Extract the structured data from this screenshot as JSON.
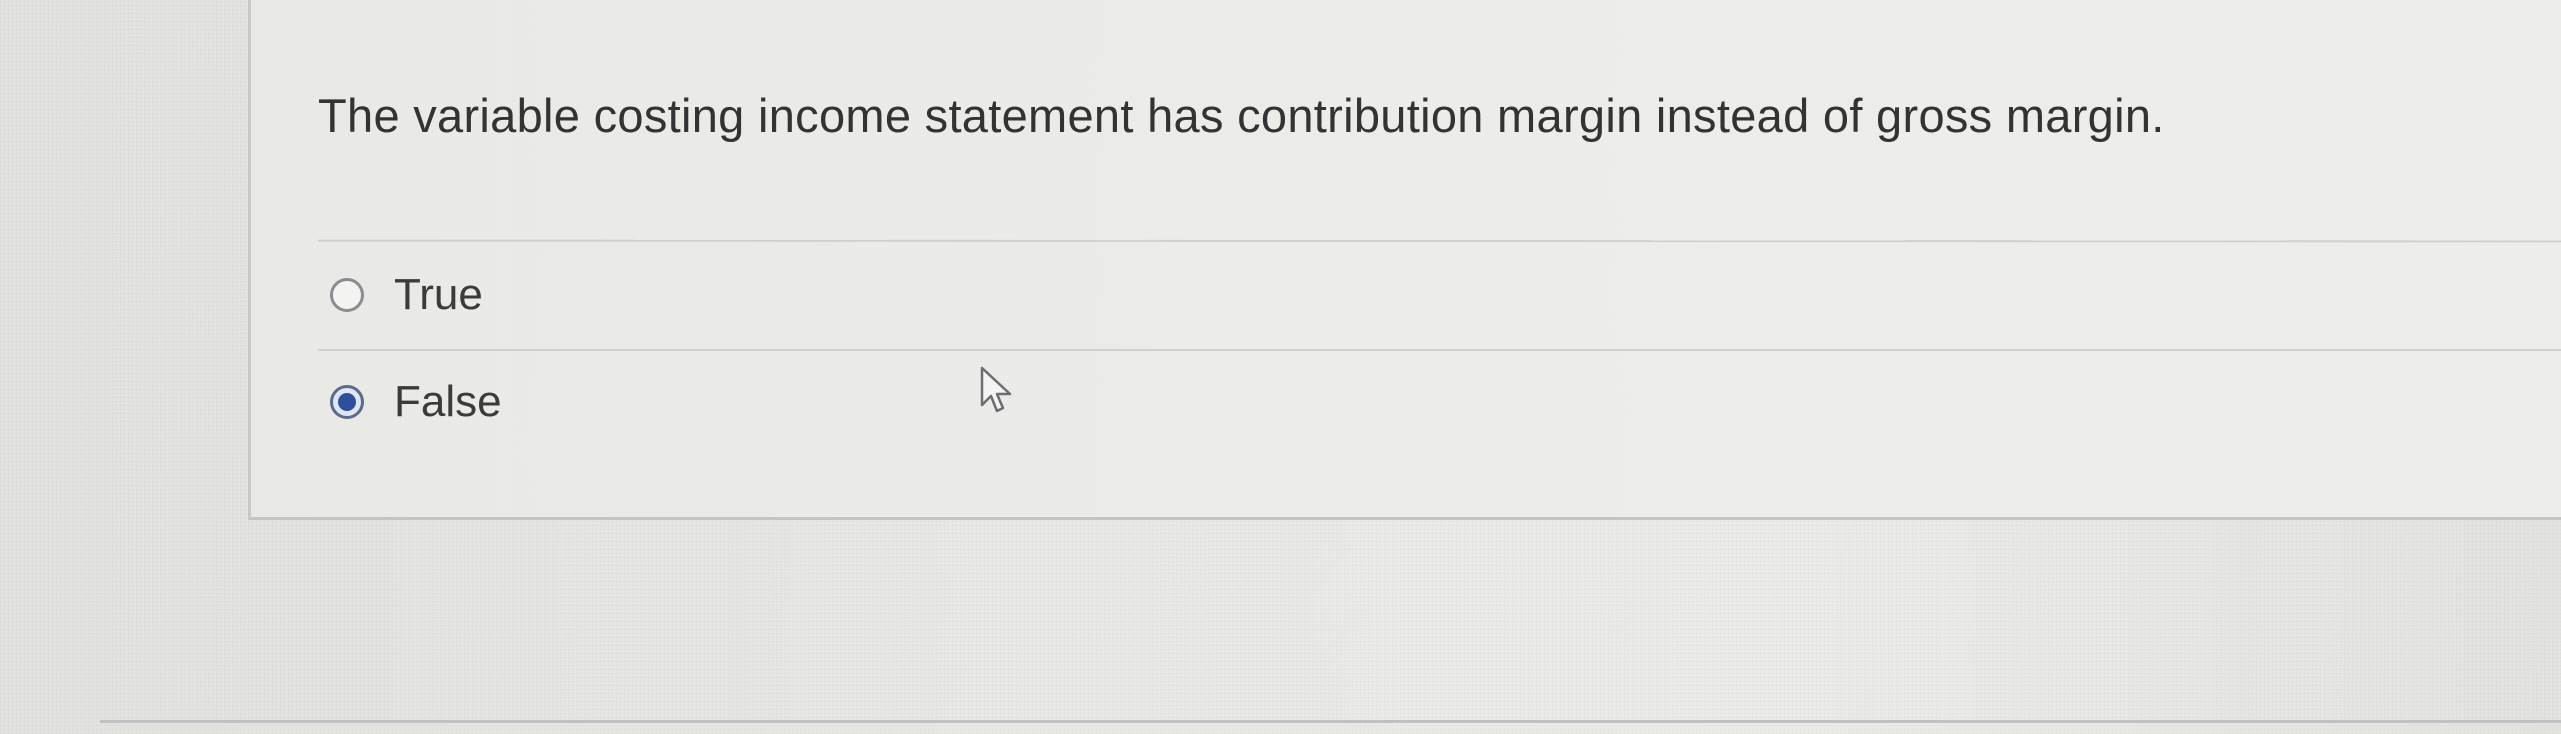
{
  "question": {
    "text": "The variable costing income statement has contribution margin instead of gross margin."
  },
  "answers": [
    {
      "label": "True",
      "selected": false
    },
    {
      "label": "False",
      "selected": true
    }
  ],
  "colors": {
    "selected_radio": "#2f4f9c",
    "text": "#333333",
    "background": "#e8e8e5"
  },
  "icons": {
    "cursor": "mouse-pointer-icon"
  }
}
